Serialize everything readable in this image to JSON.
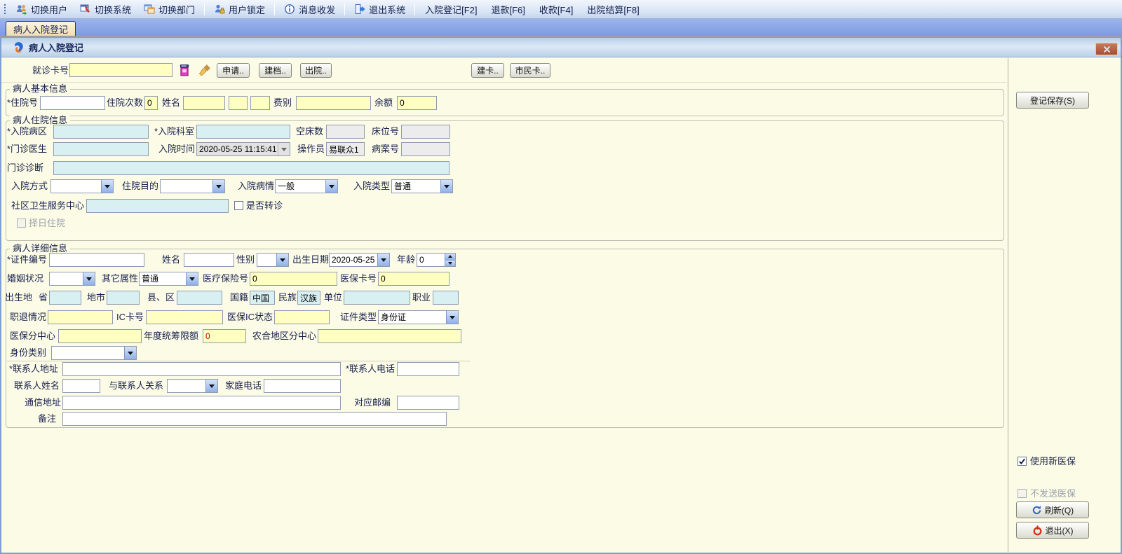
{
  "toolbar": {
    "buttons": [
      {
        "label": "切换用户"
      },
      {
        "label": "切换系统"
      },
      {
        "label": "切换部门"
      },
      {
        "label": "用户锁定"
      },
      {
        "label": "消息收发"
      },
      {
        "label": "退出系统"
      }
    ],
    "shortcuts": [
      "入院登记[F2]",
      "退款[F6]",
      "收款[F4]",
      "出院结算[F8]"
    ]
  },
  "tab": {
    "label": "病人入院登记"
  },
  "window": {
    "title": "病人入院登记"
  },
  "card_row": {
    "card_no_label": "就诊卡号",
    "apply_btn": "申请..",
    "archive_btn": "建档..",
    "discharge_btn": "出院..",
    "create_card_btn": "建卡..",
    "citizen_card_btn": "市民卡.."
  },
  "basic": {
    "title": "病人基本信息",
    "inpatient_no_label": "*住院号",
    "admission_count_label": "住院次数",
    "admission_count_value": "0",
    "name_label": "姓名",
    "fee_type_label": "费别",
    "balance_label": "余额",
    "balance_value": "0"
  },
  "hosp": {
    "title": "病人住院信息",
    "ward_label": "*入院病区",
    "dept_label": "*入院科室",
    "empty_beds_label": "空床数",
    "bed_no_label": "床位号",
    "doctor_label": "*门诊医生",
    "time_label": "入院时间",
    "time_value": "2020-05-25 11:15:41",
    "operator_label": "操作员",
    "operator_value": "易联众1",
    "record_no_label": "病案号",
    "diagnosis_label": "门诊诊断",
    "method_label": "入院方式",
    "purpose_label": "住院目的",
    "condition_label": "入院病情",
    "condition_value": "一般",
    "type_label": "入院类型",
    "type_value": "普通",
    "community_label": "社区卫生服务中心",
    "referral_label": "是否转诊",
    "scheduled_label": "择日住院"
  },
  "detail": {
    "title": "病人详细信息",
    "id_no_label": "*证件编号",
    "name_label": "姓名",
    "gender_label": "性别",
    "birth_label": "出生日期",
    "birth_value": "2020-05-25",
    "age_label": "年龄",
    "age_value": "0",
    "marital_label": "婚姻状况",
    "attr_label": "其它属性",
    "attr_value": "普通",
    "ins_no_label": "医疗保险号",
    "ins_no_value": "0",
    "ins_card_label": "医保卡号",
    "ins_card_value": "0",
    "birthplace_label": "出生地",
    "province_label": "省",
    "city_label": "地市",
    "county_label": "县、区",
    "nation_label": "国籍",
    "nation_value": "中国",
    "ethnic_label": "民族",
    "ethnic_value": "汉族",
    "unit_label": "单位",
    "job_label": "职业",
    "employ_label": "职退情况",
    "ic_label": "IC卡号",
    "ins_ic_label": "医保IC状态",
    "id_type_label": "证件类型",
    "id_type_value": "身份证",
    "ins_branch_label": "医保分中心",
    "limit_label": "年度统筹限额",
    "limit_value": "0",
    "rural_label": "农合地区分中心",
    "identity_label": "身份类别",
    "contact_addr_label": "*联系人地址",
    "contact_tel_label": "*联系人电话",
    "contact_name_label": "联系人姓名",
    "relation_label": "与联系人关系",
    "home_tel_label": "家庭电话",
    "mail_addr_label": "通信地址",
    "zip_label": "对应邮编",
    "remark_label": "备注"
  },
  "right_panel": {
    "save_btn": "登记保存(S)",
    "use_new_ins_label": "使用新医保",
    "no_send_ins_label": "不发送医保",
    "refresh_btn": "刷新(Q)",
    "exit_btn": "退出(X)"
  },
  "colors": {
    "accent_blue": "#7da0d4",
    "content_bg": "#fcfce6",
    "input_yellow": "#ffffc2",
    "input_cyan": "#d8f0f2",
    "tab_orange": "#cf9450",
    "close_red": "#a44c34"
  }
}
